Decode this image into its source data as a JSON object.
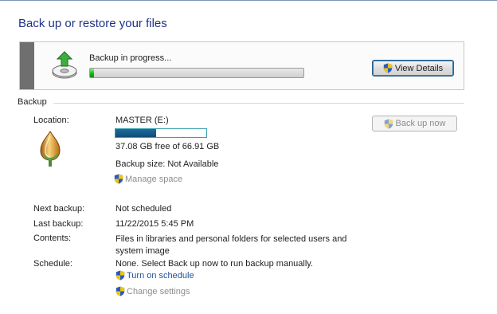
{
  "page": {
    "title": "Back up or restore your files"
  },
  "progress": {
    "status": "Backup in progress...",
    "fraction": 0.02,
    "view_details_label": "View Details"
  },
  "backup": {
    "section_label": "Backup",
    "location_label": "Location:",
    "location_value": "MASTER (E:)",
    "disk_used_fraction": 0.45,
    "free_space": "37.08 GB free of 66.91 GB",
    "backup_size": "Backup size: Not Available",
    "manage_space": "Manage space",
    "back_up_now": "Back up now",
    "next_backup_label": "Next backup:",
    "next_backup_value": "Not scheduled",
    "last_backup_label": "Last backup:",
    "last_backup_value": "11/22/2015 5:45 PM",
    "contents_label": "Contents:",
    "contents_value": "Files in libraries and personal folders for selected users and system image",
    "schedule_label": "Schedule:",
    "schedule_value": "None. Select Back up now to run backup manually.",
    "turn_on_schedule": "Turn on schedule",
    "change_settings": "Change settings"
  },
  "colors": {
    "title": "#1e3287",
    "link": "#1e50a0",
    "progress_fill": "#1fb41f",
    "disk_fill": "#0e4c7a"
  },
  "icons": {
    "backup": "backup-drive-icon",
    "drive": "drive-bulb-icon",
    "shield": "uac-shield-icon"
  }
}
